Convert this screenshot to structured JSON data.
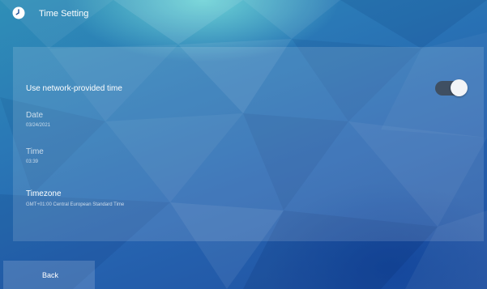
{
  "header": {
    "icon": "clock-icon",
    "title": "Time Setting"
  },
  "settings": {
    "network_time": {
      "label": "Use network-provided time",
      "enabled": true
    },
    "date": {
      "label": "Date",
      "value": "03/24/2021"
    },
    "time": {
      "label": "Time",
      "value": "03:39"
    },
    "timezone": {
      "label": "Timezone",
      "value": "GMT+01:00 Central European Standard Time"
    }
  },
  "footer": {
    "back_label": "Back"
  },
  "colors": {
    "background_primary": "#2664b0",
    "background_highlight": "#78e1dc",
    "toggle_track": "#3f4f62",
    "toggle_thumb": "#f2f4f7",
    "text_primary": "#ffffff"
  }
}
